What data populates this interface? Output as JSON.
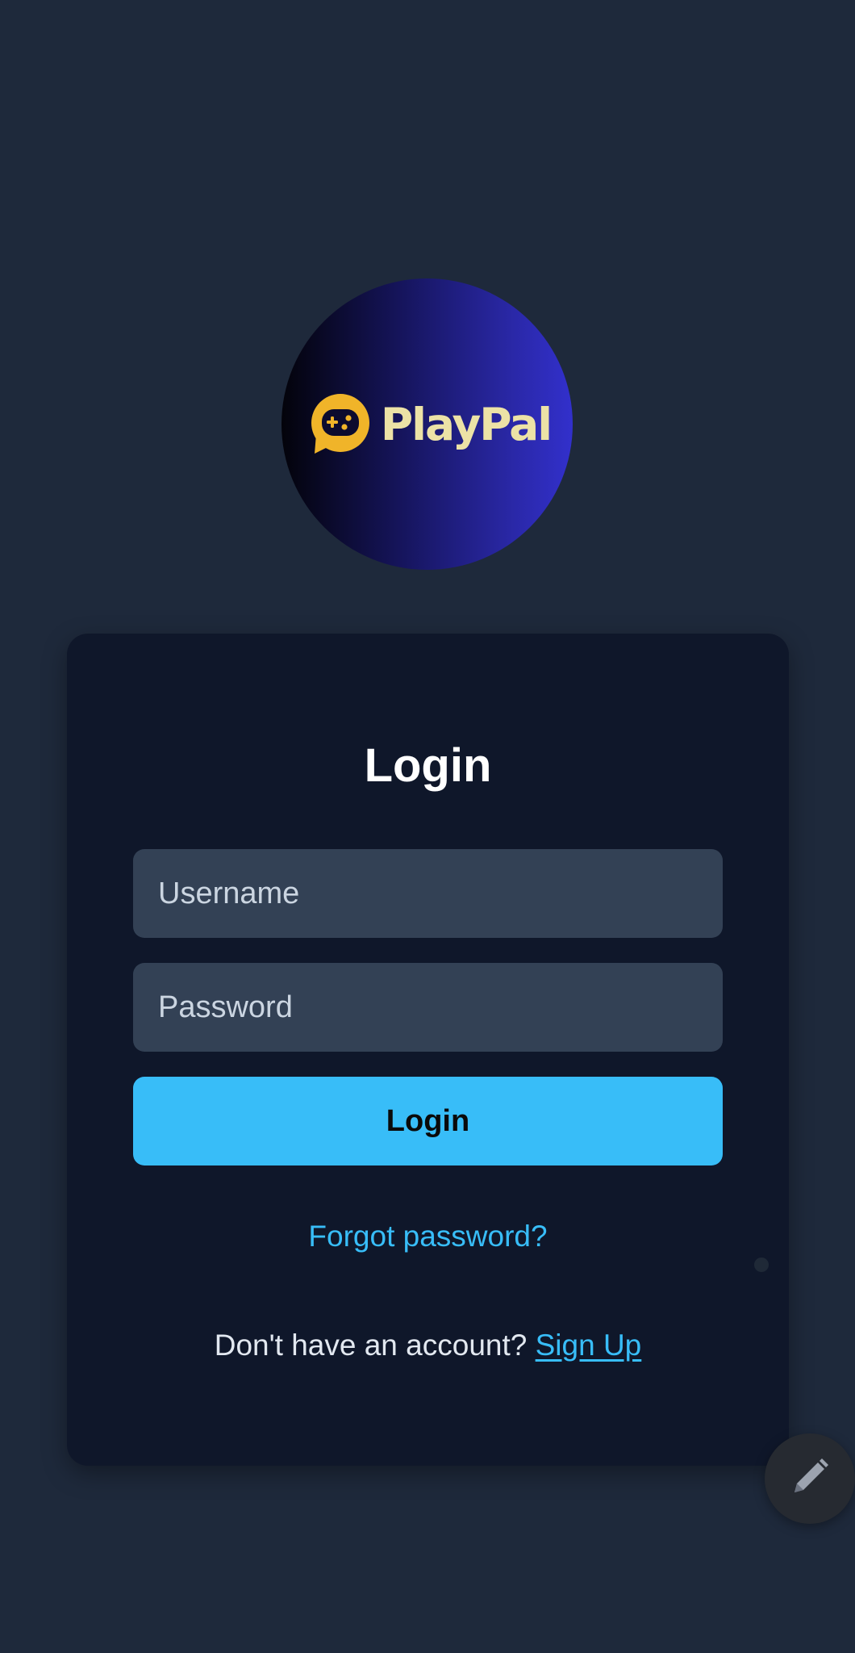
{
  "logo": {
    "text": "PlayPal",
    "icon": "gamepad-chat-icon",
    "text_color": "#ece2a6",
    "icon_color": "#f0b429"
  },
  "login_card": {
    "title": "Login",
    "username_placeholder": "Username",
    "username_value": "",
    "password_placeholder": "Password",
    "password_value": "",
    "login_button_label": "Login",
    "forgot_password_link": "Forgot password?",
    "signup_prompt": "Don't have an account? ",
    "signup_link": "Sign Up"
  },
  "floating_action": {
    "icon": "pencil-icon"
  },
  "colors": {
    "background": "#1e293b",
    "card": "#0f172a",
    "input": "#334155",
    "accent": "#38bdf8"
  }
}
